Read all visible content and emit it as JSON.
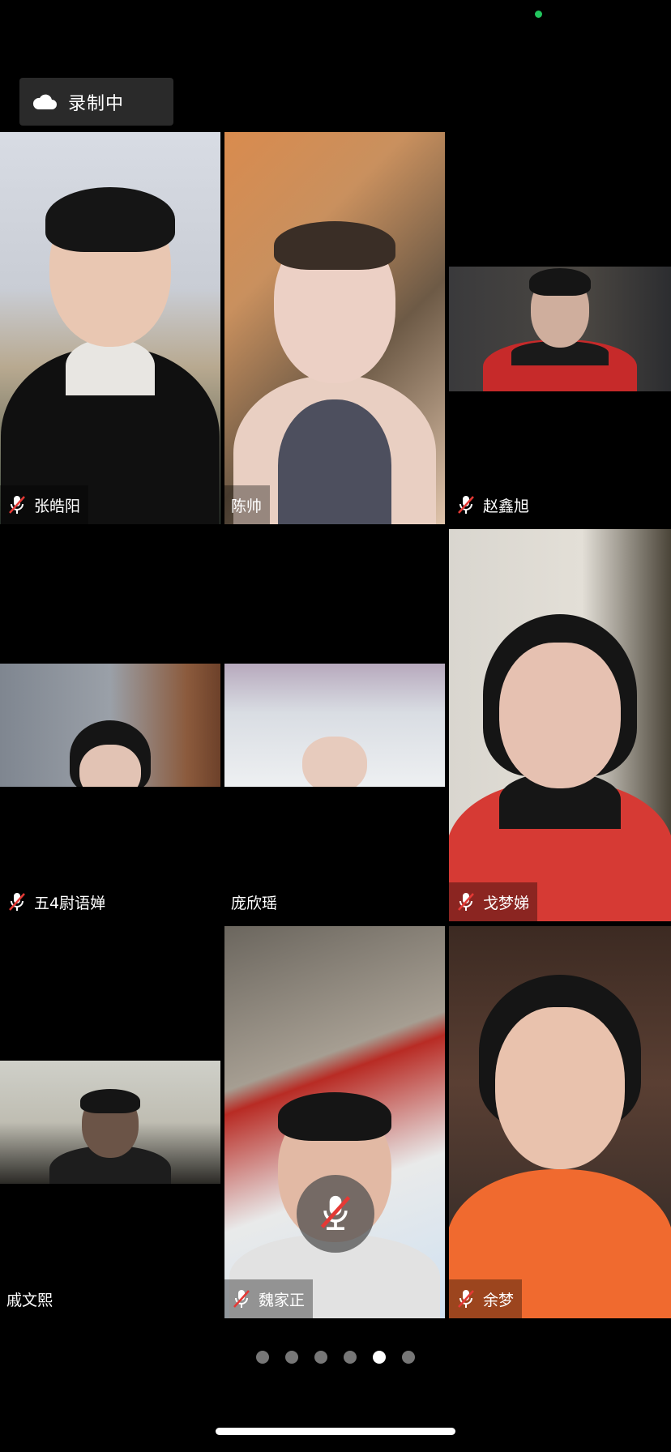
{
  "status": {
    "indicator_color": "#22c55e"
  },
  "recording": {
    "icon": "cloud-icon",
    "label": "录制中"
  },
  "participants": [
    {
      "name": "张皓阳",
      "muted": true,
      "icon": "mic-muted-icon"
    },
    {
      "name": "陈帅",
      "muted": false
    },
    {
      "name": "赵鑫旭",
      "muted": true,
      "icon": "mic-muted-icon"
    },
    {
      "name": "五4尉语婵",
      "muted": true,
      "icon": "mic-muted-icon"
    },
    {
      "name": "庞欣瑶",
      "muted": false
    },
    {
      "name": "戈梦娣",
      "muted": true,
      "icon": "mic-muted-icon"
    },
    {
      "name": "戚文熙",
      "muted": false
    },
    {
      "name": "魏家正",
      "muted": true,
      "icon": "mic-muted-icon"
    },
    {
      "name": "余梦",
      "muted": true,
      "icon": "mic-muted-icon"
    }
  ],
  "self_mic": {
    "icon": "mic-muted-icon",
    "muted": true
  },
  "pager": {
    "total_pages": 6,
    "current_page": 5
  },
  "colors": {
    "background": "#000000",
    "mute_slash": "#e53935"
  }
}
